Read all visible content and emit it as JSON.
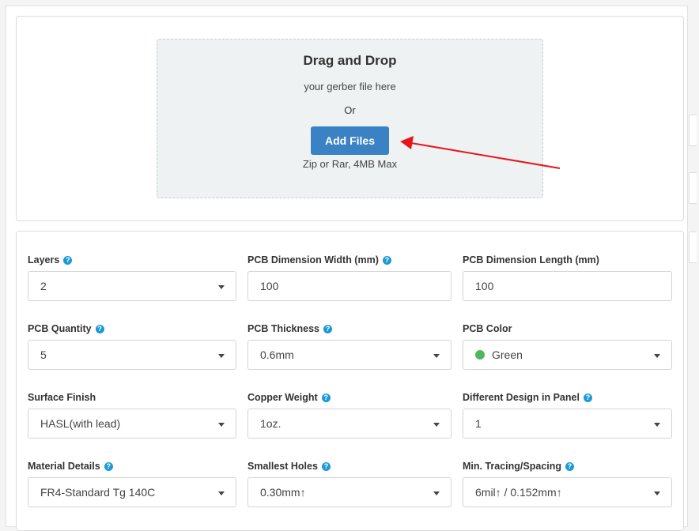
{
  "upload": {
    "title": "Drag and Drop",
    "subtitle": "your gerber file here",
    "or": "Or",
    "button": "Add Files",
    "note": "Zip or Rar, 4MB Max"
  },
  "annotation_color": "#e8141c",
  "fields": [
    {
      "label": "Layers",
      "help": true,
      "value": "2",
      "type": "select"
    },
    {
      "label": "PCB Dimension Width (mm)",
      "help": true,
      "value": "100",
      "type": "input"
    },
    {
      "label": "PCB Dimension Length (mm)",
      "help": false,
      "value": "100",
      "type": "input"
    },
    {
      "label": "PCB Quantity",
      "help": true,
      "value": "5",
      "type": "select"
    },
    {
      "label": "PCB Thickness",
      "help": true,
      "value": "0.6mm",
      "type": "select"
    },
    {
      "label": "PCB Color",
      "help": false,
      "value": "Green",
      "type": "select",
      "swatch": "#4cb862"
    },
    {
      "label": "Surface Finish",
      "help": false,
      "value": "HASL(with lead)",
      "type": "select"
    },
    {
      "label": "Copper Weight",
      "help": true,
      "value": "1oz.",
      "type": "select"
    },
    {
      "label": "Different Design in Panel",
      "help": true,
      "value": "1",
      "type": "select"
    },
    {
      "label": "Material Details",
      "help": true,
      "value": "FR4-Standard Tg 140C",
      "type": "select"
    },
    {
      "label": "Smallest Holes",
      "help": true,
      "value": "0.30mm↑",
      "type": "select"
    },
    {
      "label": "Min. Tracing/Spacing",
      "help": true,
      "value": "6mil↑ / 0.152mm↑",
      "type": "select"
    }
  ],
  "help_glyph": "?"
}
